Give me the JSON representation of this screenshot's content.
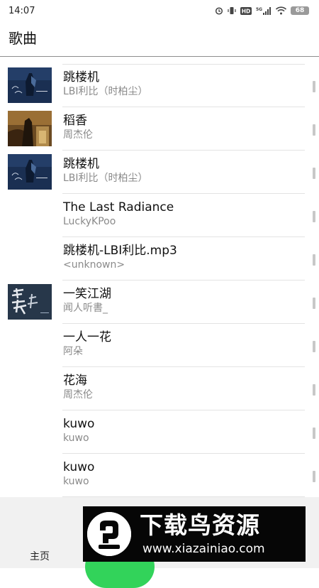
{
  "status_bar": {
    "time": "14:07",
    "battery": "68",
    "icons": [
      "alarm-icon",
      "vibrate-icon",
      "hd-icon",
      "5g-signal-icon",
      "wifi-icon",
      "battery-icon"
    ]
  },
  "header": {
    "title": "歌曲"
  },
  "songs": [
    {
      "title": "跳楼机",
      "artist": "LBI利比（时柏尘）",
      "cover": "album-cover-art"
    },
    {
      "title": "稻香",
      "artist": "周杰伦",
      "cover": "album-cover-art"
    },
    {
      "title": "跳楼机",
      "artist": "LBI利比（时柏尘）",
      "cover": "album-cover-art"
    },
    {
      "title": "The Last Radiance",
      "artist": "LuckyKPoo",
      "cover": null
    },
    {
      "title": "跳楼机-LBI利比.mp3",
      "artist": "<unknown>",
      "cover": null
    },
    {
      "title": "一笑江湖",
      "artist": "闻人听書_",
      "cover": "album-cover-art"
    },
    {
      "title": "一人一花",
      "artist": "阿朵",
      "cover": null
    },
    {
      "title": "花海",
      "artist": "周杰伦",
      "cover": null
    },
    {
      "title": "kuwo",
      "artist": "kuwo",
      "cover": null
    },
    {
      "title": "kuwo",
      "artist": "kuwo",
      "cover": null
    }
  ],
  "bottom_nav": {
    "home_label": "主页",
    "accent_color": "#32d35a"
  },
  "watermark": {
    "title": "下载鸟资源",
    "url": "www.xiazainiao.com"
  },
  "colors": {
    "divider": "#8d8d8d",
    "artist_text": "#8a8a8a",
    "nav_background": "#f1f1f1"
  }
}
